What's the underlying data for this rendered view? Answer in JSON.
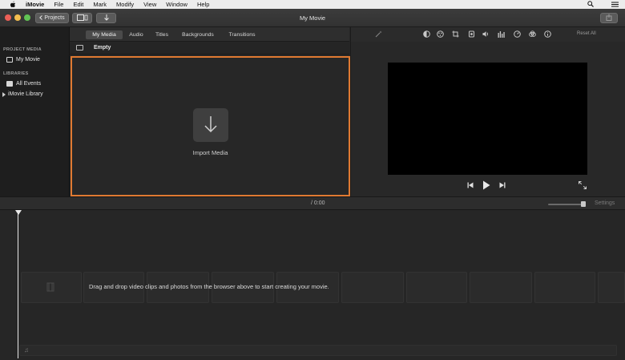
{
  "menubar": {
    "app_name": "iMovie",
    "items": [
      "File",
      "Edit",
      "Mark",
      "Modify",
      "View",
      "Window",
      "Help"
    ]
  },
  "toolbar": {
    "projects_label": "Projects",
    "window_title": "My Movie"
  },
  "sidebar": {
    "project_media_header": "PROJECT MEDIA",
    "project_item": "My Movie",
    "libraries_header": "LIBRARIES",
    "all_events": "All Events",
    "library_item": "iMovie Library"
  },
  "browser": {
    "tabs": [
      "My Media",
      "Audio",
      "Titles",
      "Backgrounds",
      "Transitions"
    ],
    "active_tab": "My Media",
    "filter_label": "Empty",
    "import_label": "Import Media"
  },
  "viewer": {
    "reset_all": "Reset All"
  },
  "timeline": {
    "timecode": "/ 0:00",
    "settings_label": "Settings",
    "zoom_level": 0.9,
    "drop_message": "Drag and drop video clips and photos from the browser above to start creating your movie.",
    "music_glyph": "♫"
  },
  "colors": {
    "accent_orange": "#e07a32",
    "close": "#ec5f57",
    "minimize": "#f4be4f",
    "zoom": "#61c454"
  },
  "icons": {
    "menubar": [
      "apple-icon",
      "search-icon",
      "list-icon"
    ],
    "viewer_adjustments": [
      "magic-wand-icon",
      "color-balance-icon",
      "color-palette-icon",
      "crop-icon",
      "camera-icon",
      "volume-icon",
      "equalizer-icon",
      "speed-icon",
      "filter-icon",
      "info-icon"
    ],
    "playback": [
      "skip-back-icon",
      "play-icon",
      "skip-forward-icon",
      "fullscreen-icon"
    ]
  }
}
